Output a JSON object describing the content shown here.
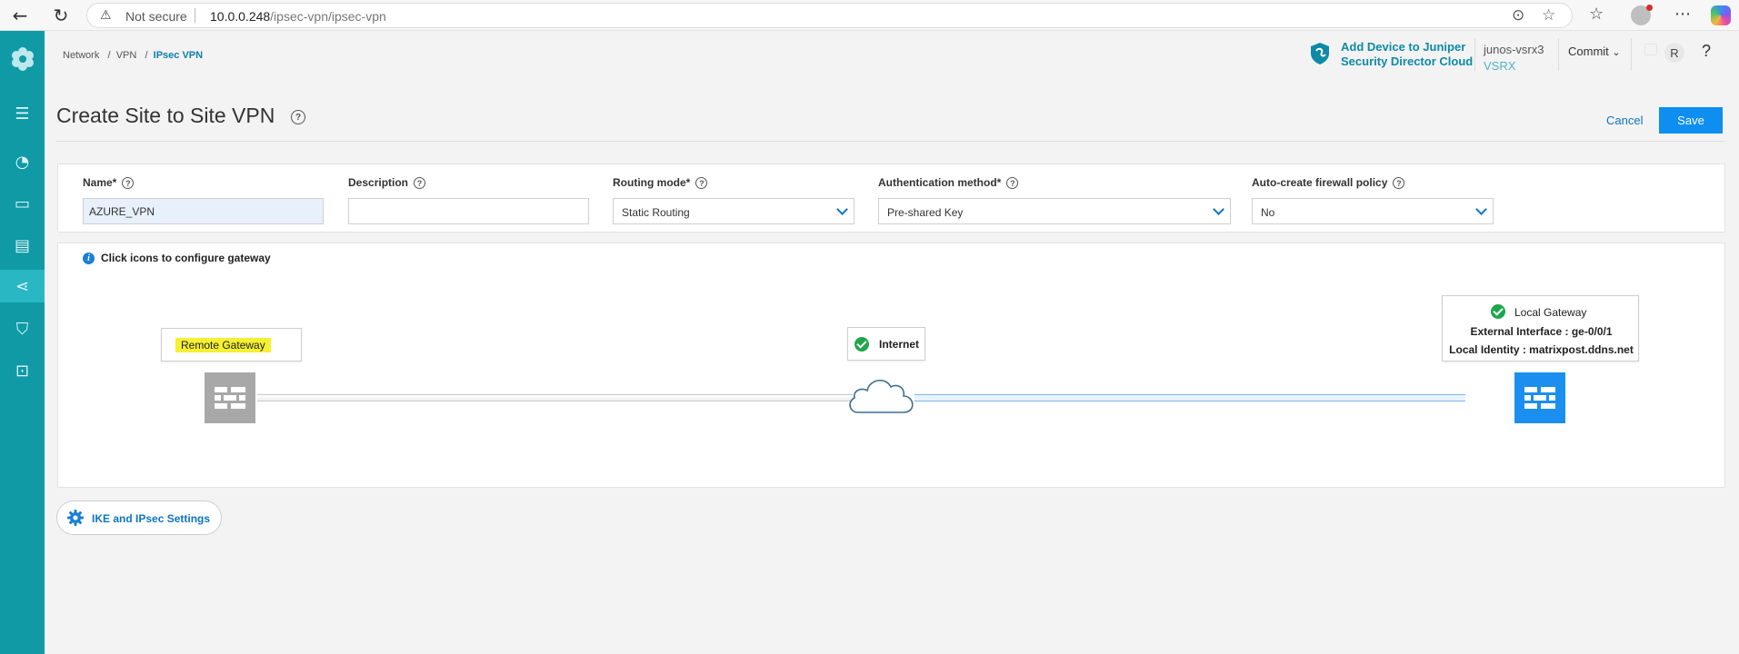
{
  "browser": {
    "security_label": "Not secure",
    "url_host": "10.0.0.248",
    "url_path": "/ipsec-vpn/ipsec-vpn"
  },
  "breadcrumb": {
    "items": [
      "Network",
      "VPN",
      "IPsec VPN"
    ]
  },
  "header": {
    "juniper_line1": "Add Device to Juniper",
    "juniper_line2": "Security Director Cloud",
    "device_name": "junos-vsrx3",
    "device_type": "VSRX",
    "commit_label": "Commit",
    "user_initial": "R",
    "help_label": "?"
  },
  "page": {
    "title": "Create Site to Site VPN",
    "cancel_label": "Cancel",
    "save_label": "Save"
  },
  "form": {
    "name_label": "Name*",
    "name_value": "AZURE_VPN",
    "description_label": "Description",
    "description_value": "",
    "routing_label": "Routing mode*",
    "routing_value": "Static Routing",
    "auth_label": "Authentication method*",
    "auth_value": "Pre-shared Key",
    "firewall_label": "Auto-create firewall policy",
    "firewall_value": "No"
  },
  "diagram": {
    "info_text": "Click icons to configure gateway",
    "remote_label": "Remote Gateway",
    "internet_label": "Internet",
    "local_title": "Local Gateway",
    "local_interface": "External Interface : ge-0/0/1",
    "local_identity": "Local Identity : matrixpost.ddns.net"
  },
  "settings_button_label": "IKE and IPsec Settings",
  "colors": {
    "rail": "#0f9aa6",
    "accent": "#0d8ef0",
    "local_gateway": "#1a8ff0",
    "remote_gateway": "#a8a8a8",
    "highlight": "#f5f032",
    "success": "#1fa64c"
  }
}
